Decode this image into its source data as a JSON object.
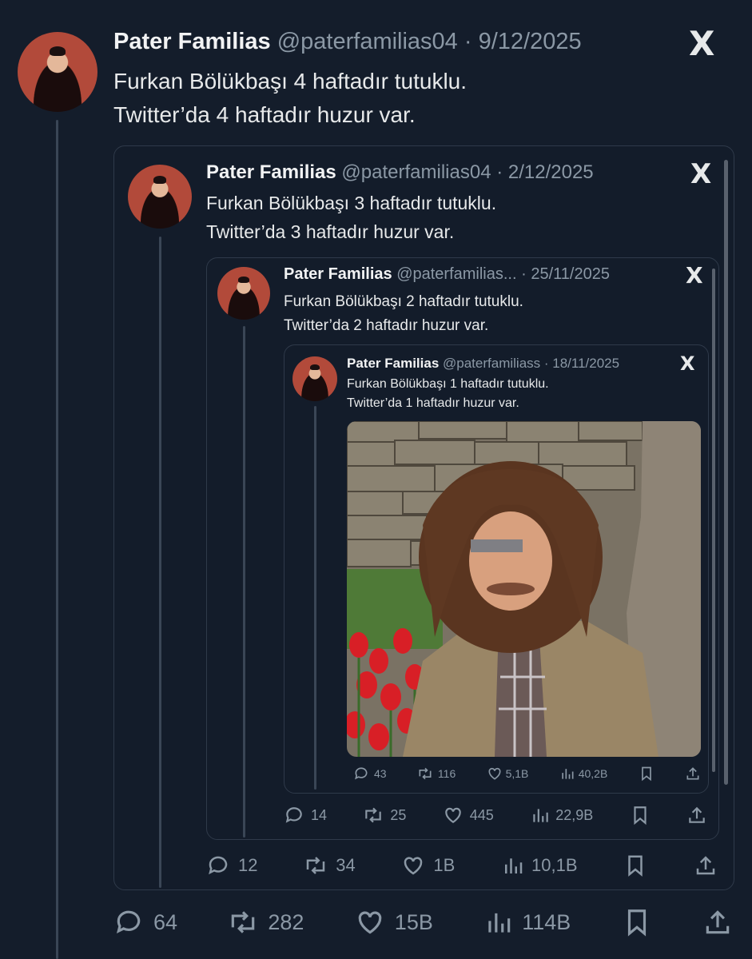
{
  "t1": {
    "name": "Pater Familias",
    "handle": "@paterfamilias04",
    "date": "· 9/12/2025",
    "line1": "Furkan Bölükbaşı 4 haftadır tutuklu.",
    "line2": "Twitter’da 4 haftadır huzur var.",
    "stats": {
      "replies": "64",
      "reposts": "282",
      "likes": "15B",
      "views": "114B"
    }
  },
  "t2": {
    "name": "Pater Familias",
    "handle": "@paterfamilias04",
    "date": "· 2/12/2025",
    "line1": "Furkan Bölükbaşı 3 haftadır tutuklu.",
    "line2": "Twitter’da 3 haftadır huzur var.",
    "stats": {
      "replies": "12",
      "reposts": "34",
      "likes": "1B",
      "views": "10,1B"
    }
  },
  "t3": {
    "name": "Pater Familias",
    "handle": "@paterfamilias...",
    "date": "· 25/11/2025",
    "line1": "Furkan Bölükbaşı 2 haftadır tutuklu.",
    "line2": "Twitter’da 2 haftadır huzur var.",
    "stats": {
      "replies": "14",
      "reposts": "25",
      "likes": "445",
      "views": "22,9B"
    }
  },
  "t4": {
    "name": "Pater Familias",
    "handle": "@paterfamiliass",
    "date": "· 18/11/2025",
    "line1": "Furkan Bölükbaşı 1 haftadır tutuklu.",
    "line2": "Twitter’da 1 haftadır huzur var.",
    "stats": {
      "replies": "43",
      "reposts": "116",
      "likes": "5,1B",
      "views": "40,2B"
    }
  },
  "x_logo": "X",
  "icons": [
    "reply-icon",
    "repost-icon",
    "like-icon",
    "views-icon",
    "bookmark-icon",
    "share-icon"
  ]
}
